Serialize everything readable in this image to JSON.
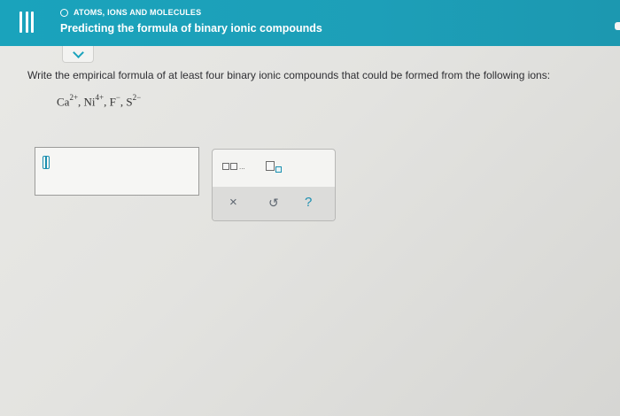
{
  "header": {
    "topic": "ATOMS, IONS AND MOLECULES",
    "title": "Predicting the formula of binary ionic compounds"
  },
  "question": {
    "prompt": "Write the empirical formula of at least four binary ionic compounds that could be formed from the following ions:",
    "ions": [
      {
        "symbol": "Ca",
        "charge": "2+"
      },
      {
        "symbol": "Ni",
        "charge": "4+"
      },
      {
        "symbol": "F",
        "charge": "−"
      },
      {
        "symbol": "S",
        "charge": "2−"
      }
    ]
  },
  "toolbar": {
    "clear_symbol": "×",
    "undo_symbol": "↺",
    "help_symbol": "?",
    "ellipsis": "..."
  },
  "icons": {
    "menu": "menu-icon",
    "topic": "circle-icon",
    "collapse": "chevron-down-icon",
    "cursor": "text-cursor-icon",
    "multi_box": "multiple-boxes-icon",
    "subscript": "subscript-icon"
  },
  "colors": {
    "header": "#1aa3bc",
    "accent": "#1b8fb0",
    "text": "#2f2f33"
  }
}
